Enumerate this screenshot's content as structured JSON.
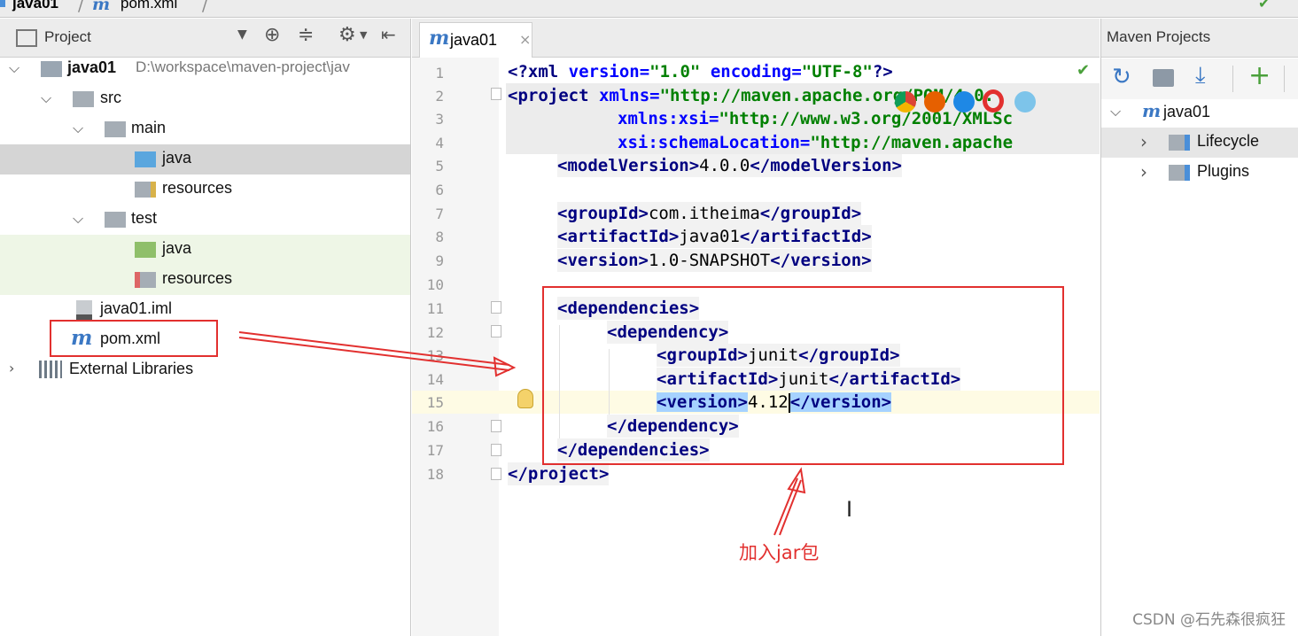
{
  "topbar": {
    "project_crumb": "java01",
    "file_crumb": "pom.xml"
  },
  "project_panel": {
    "title": "Project",
    "tree": [
      {
        "label": "java01",
        "path": "D:\\workspace\\maven-project\\jav"
      },
      {
        "label": "src"
      },
      {
        "label": "main"
      },
      {
        "label": "java"
      },
      {
        "label": "resources"
      },
      {
        "label": "test"
      },
      {
        "label": "java"
      },
      {
        "label": "resources"
      },
      {
        "label": "java01.iml"
      },
      {
        "label": "pom.xml"
      },
      {
        "label": "External Libraries"
      }
    ]
  },
  "editor": {
    "tab_label": "java01",
    "tab_close": "×",
    "line_numbers": [
      "1",
      "2",
      "3",
      "4",
      "5",
      "6",
      "7",
      "8",
      "9",
      "10",
      "11",
      "12",
      "13",
      "14",
      "15",
      "16",
      "17",
      "18"
    ],
    "xml": {
      "l1_decl": "<?xml",
      "l1_version_attr": "version=",
      "l1_version_val": "\"1.0\"",
      "l1_enc_attr": "encoding=",
      "l1_enc_val": "\"UTF-8\"",
      "l1_end": "?>",
      "l2_open": "<project",
      "l2_attr": "xmlns=",
      "l2_val": "\"http://maven.apache.org/POM/4.0.",
      "l3_attr": "xmlns:xsi=",
      "l3_val": "\"http://www.w3.org/2001/XMLSc",
      "l4_attr": "xsi:schemaLocation=",
      "l4_val": "\"http://maven.apache",
      "l5": [
        "<modelVersion>",
        "4.0.0",
        "</modelVersion>"
      ],
      "l7": [
        "<groupId>",
        "com.itheima",
        "</groupId>"
      ],
      "l8": [
        "<artifactId>",
        "java01",
        "</artifactId>"
      ],
      "l9": [
        "<version>",
        "1.0-SNAPSHOT",
        "</version>"
      ],
      "l11": "<dependencies>",
      "l12": "<dependency>",
      "l13": [
        "<groupId>",
        "junit",
        "</groupId>"
      ],
      "l14": [
        "<artifactId>",
        "junit",
        "</artifactId>"
      ],
      "l15": [
        "<version>",
        "4.12",
        "</version>"
      ],
      "l16": "</dependency>",
      "l17": "</dependencies>",
      "l18": "</project>"
    }
  },
  "maven_panel": {
    "title": "Maven Projects",
    "tree": [
      {
        "label": "java01"
      },
      {
        "label": "Lifecycle"
      },
      {
        "label": "Plugins"
      }
    ]
  },
  "annotation": {
    "label": "加入jar包"
  },
  "watermark": "CSDN @石先森很疯狂",
  "colors": {
    "accent_red": "#e2302f",
    "selection": "#d5d5d5",
    "tag": "#000080",
    "string": "#008000",
    "attr": "#0000ff"
  }
}
